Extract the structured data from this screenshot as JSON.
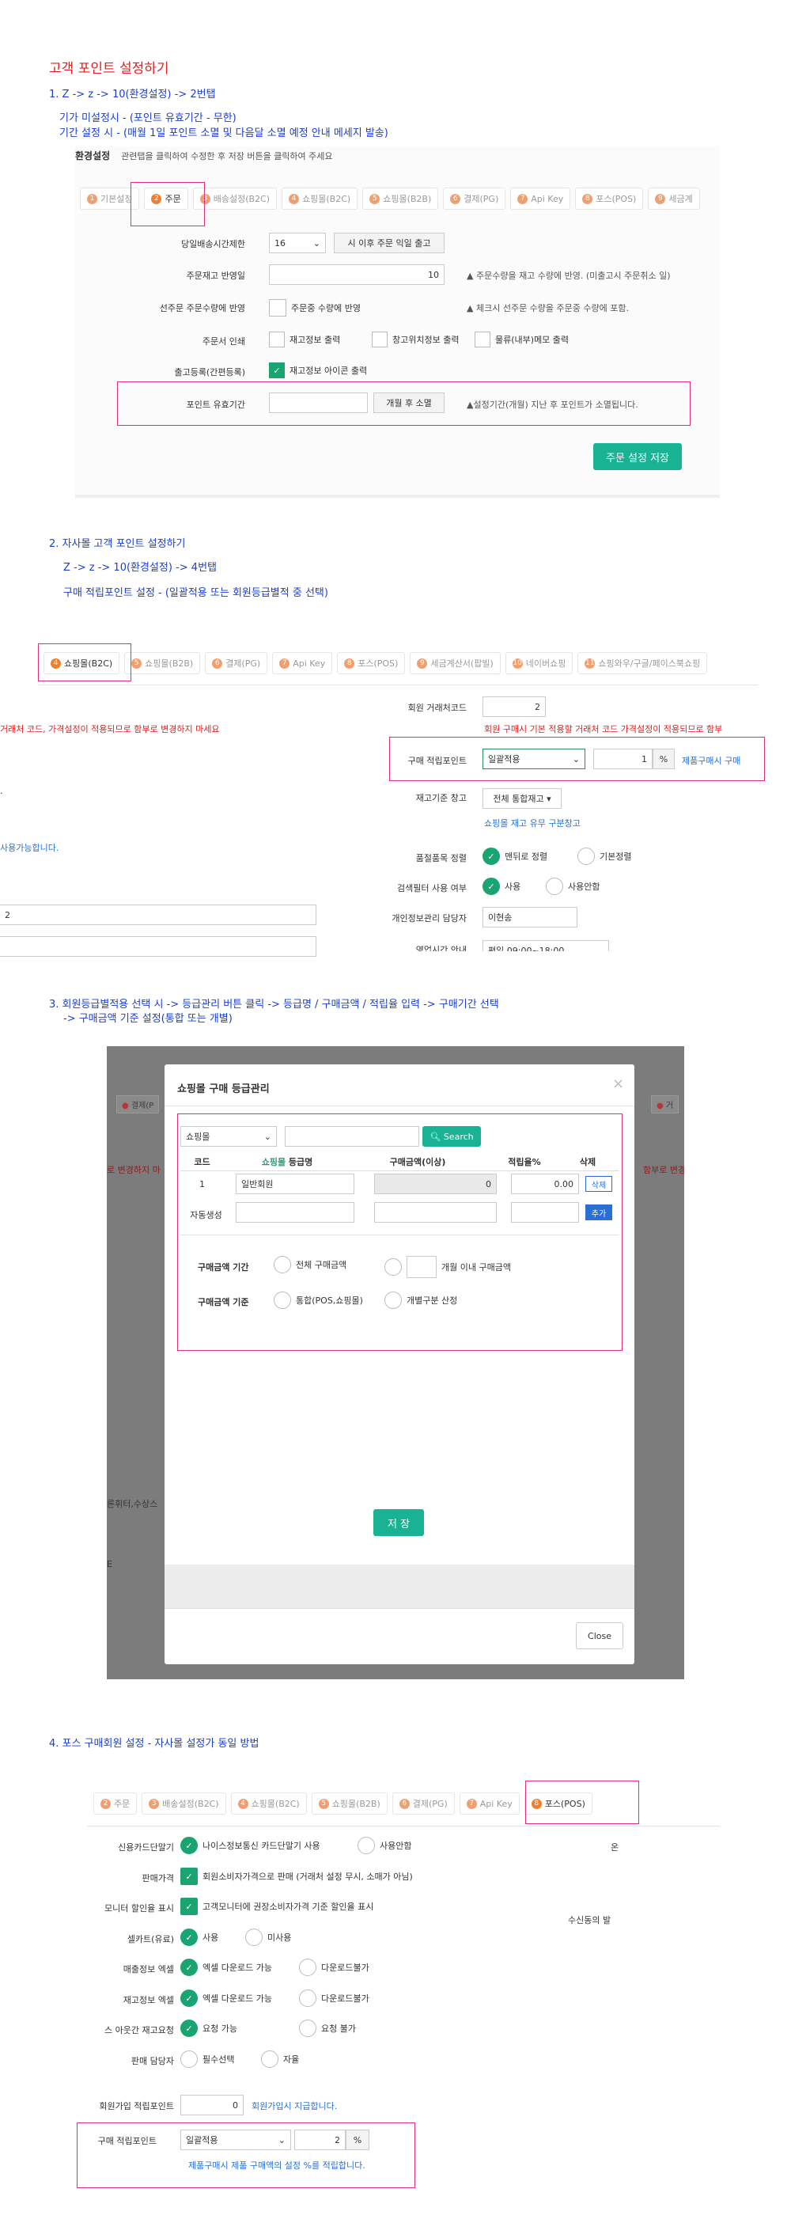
{
  "section1": {
    "title": "고객 포인트 설정하기",
    "step": "1. Z -> z -> 10(환경설정) -> 2번탭",
    "note1": "기가 미설정시 - (포인트 유효기간 - 무한)",
    "note2": "기간 설정 시 - (매월 1일 포인트 소멸 및 다음달 소멸 예정 안내 메세지 발송)",
    "env_label": "환경설정",
    "env_desc": "관련탭을 클릭하여 수정한 후 저장 버튼을 클릭하여 주세요",
    "tabs": [
      {
        "num": "1",
        "label": "기본설정"
      },
      {
        "num": "2",
        "label": "주문"
      },
      {
        "num": "3",
        "label": "배송설정(B2C)"
      },
      {
        "num": "4",
        "label": "쇼핑몰(B2C)"
      },
      {
        "num": "5",
        "label": "쇼핑몰(B2B)"
      },
      {
        "num": "6",
        "label": "결제(PG)"
      },
      {
        "num": "7",
        "label": "Api Key"
      },
      {
        "num": "8",
        "label": "포스(POS)"
      },
      {
        "num": "9",
        "label": "세금계"
      }
    ],
    "rows": {
      "shipping_limit": {
        "label": "당일배송시간제한",
        "value": "16",
        "button": "시 이후 주문 익일 출고"
      },
      "stock_reflect": {
        "label": "주문재고 반영일",
        "value": "10",
        "note": "주문수량을 재고 수량에 반영. (미출고시 주문취소 일)"
      },
      "preorder": {
        "label": "선주문 주문수량에 반영",
        "check": "주문중 수량에 반영",
        "note": "체크시 선주문 수량을 주문중 수량에 포함."
      },
      "print": {
        "label": "주문서 인쇄",
        "opt1": "재고정보 출력",
        "opt2": "창고위치정보 출력",
        "opt3": "물류(내부)메모 출력"
      },
      "ship_reg": {
        "label": "출고등록(간편등록)",
        "opt1": "재고정보 아이콘 출력"
      },
      "point_expiry": {
        "label": "포인트 유효기간",
        "button": "개월 후 소멸",
        "note": "설정기간(개월) 지난 후 포인트가 소멸됩니다."
      }
    },
    "save_button": "주문 설정 저장"
  },
  "section2": {
    "step": "2. 자사몰 고객 포인트 설정하기",
    "sub1": "Z -> z -> 10(환경설정) -> 4번탭",
    "sub2": "구매 적립포인트 설정 - (일괄적용 또는 회원등급별적 중 선택)",
    "tabs": [
      {
        "num": "4",
        "label": "쇼핑몰(B2C)"
      },
      {
        "num": "5",
        "label": "쇼핑몰(B2B)"
      },
      {
        "num": "6",
        "label": "결제(PG)"
      },
      {
        "num": "7",
        "label": "Api Key"
      },
      {
        "num": "8",
        "label": "포스(POS)"
      },
      {
        "num": "9",
        "label": "세금계산서(팝빌)"
      },
      {
        "num": "10",
        "label": "네이버쇼핑"
      },
      {
        "num": "11",
        "label": "쇼핑와우/구글/페이스북쇼핑"
      }
    ],
    "left_red": "거래처 코드, 가격설정이 적용되므로 함부로 변경하지 마세요",
    "left_blue": "사용가능합니다.",
    "left_val": "2",
    "member_code": {
      "label": "회원 거래처코드",
      "value": "2",
      "note": "회원 구매시 기본 적용할 거래처 코드 가격설정이 적용되므로 함부"
    },
    "purchase_point": {
      "label": "구매 적립포인트",
      "select": "일괄적용",
      "value": "1",
      "unit": "%",
      "link": "제품구매시 구매"
    },
    "stock_wh": {
      "label": "재고기준 창고",
      "select": "전체 통합재고",
      "link": "쇼핑몰 재고 유무 구분창고"
    },
    "sort": {
      "label": "품절품목 정렬",
      "opt1": "맨뒤로 정렬",
      "opt2": "기본정렬"
    },
    "search_filter": {
      "label": "검색필터 사용 여부",
      "opt1": "사용",
      "opt2": "사용안함"
    },
    "privacy": {
      "label": "개인정보관리 담당자",
      "value": "이현송"
    },
    "biz_hours": {
      "label": "영업시간 안내",
      "value": "평일 09:00~18:00"
    }
  },
  "section3": {
    "step": "3. 회원등급별적용 선택 시 -> 등급관리 버튼 클릭 -> 등급명 / 구매금액 / 적립율 입력 -> 구매기간 선택",
    "step2": "-> 구매금액 기준 설정(통합 또는 개별)",
    "bg_tab1": "결제(P",
    "bg_tab2": "거",
    "bg_red_left": "로 변경하지 마",
    "bg_red_right": "함부로 변경",
    "bg_text1": "론휘터,수상스",
    "bg_text2": "E",
    "modal": {
      "title": "쇼핑몰 구매 등급관리",
      "select": "쇼핑몰",
      "search_button": "Search",
      "headers": [
        "코드",
        "쇼핑몰",
        "등급명",
        "구매금액(이상)",
        "적립율%",
        "삭제"
      ],
      "row": {
        "code": "1",
        "name": "일반회원",
        "amount": "0",
        "rate": "0.00",
        "delete": "삭제"
      },
      "auto_label": "자동생성",
      "add_button": "추가",
      "period": {
        "label": "구매금액 기간",
        "opt1": "전체 구매금액",
        "opt2": "개월 이내 구매금액"
      },
      "basis": {
        "label": "구매금액 기준",
        "opt1": "통합(POS,쇼핑몰)",
        "opt2": "개별구분 산정"
      },
      "save_button": "저 장",
      "close_button": "Close"
    }
  },
  "section4": {
    "step": "4. 포스 구매회원 설정 - 자사몰 설정가 동일 방법",
    "tabs": [
      {
        "num": "2",
        "label": "주문"
      },
      {
        "num": "3",
        "label": "배송설정(B2C)"
      },
      {
        "num": "4",
        "label": "쇼핑몰(B2C)"
      },
      {
        "num": "5",
        "label": "쇼핑몰(B2B)"
      },
      {
        "num": "6",
        "label": "결제(PG)"
      },
      {
        "num": "7",
        "label": "Api Key"
      },
      {
        "num": "8",
        "label": "포스(POS)"
      }
    ],
    "right_text1": "온",
    "right_text2": "수신동의 발",
    "rows": [
      {
        "label": "신용카드단말기",
        "opt1": "나이스정보통신 카드단말기 사용",
        "opt2": "사용안함",
        "type": "radio"
      },
      {
        "label": "판매가격",
        "opt1": "회원소비자가격으로 판매 (거래처 설정 무시, 소매가 아님)",
        "type": "check"
      },
      {
        "label": "모니터 할인율 표시",
        "opt1": "고객모니터에 권장소비자가격 기준 할인율 표시",
        "type": "check"
      },
      {
        "label": "셀카트(유료)",
        "opt1": "사용",
        "opt2": "미사용",
        "type": "radio"
      },
      {
        "label": "매출정보 엑셀",
        "opt1": "엑셀 다운로드 가능",
        "opt2": "다운로드불가",
        "type": "radio"
      },
      {
        "label": "재고정보 엑셀",
        "opt1": "엑셀 다운로드 가능",
        "opt2": "다운로드불가",
        "type": "radio"
      },
      {
        "label": "스 아웃간 재고요청",
        "opt1": "요청 가능",
        "opt2": "요청 불가",
        "type": "radio"
      },
      {
        "label": "판매 담당자",
        "opt1": "필수선택",
        "opt2": "자율",
        "type": "radio_off"
      }
    ],
    "join_point": {
      "label": "회원가입 적립포인트",
      "value": "0",
      "note": "회원가입시 지급합니다."
    },
    "purchase_point": {
      "label": "구매 적립포인트",
      "select": "일괄적용",
      "value": "2",
      "unit": "%",
      "note": "제품구매시 제품 구매액의 설정 %를 적립합니다."
    }
  }
}
